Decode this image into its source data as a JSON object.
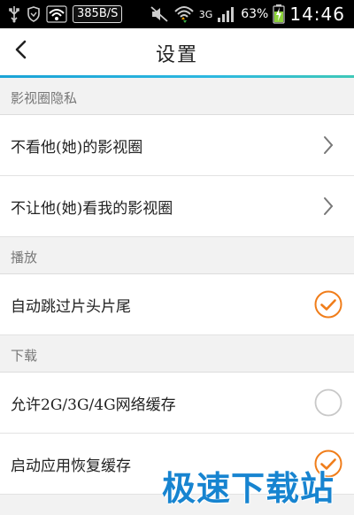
{
  "status_bar": {
    "net_speed": "385B/S",
    "network_type": "3G",
    "battery": "63%",
    "time": "14:46",
    "icons": [
      "usb-icon",
      "shield-icon",
      "wifi-icon",
      "mute-icon",
      "wifi-data-icon",
      "signal-icon",
      "battery-icon"
    ]
  },
  "header": {
    "title": "设置",
    "back_icon": "chevron-left-icon",
    "accent_color": "#1aa3d6"
  },
  "sections": [
    {
      "label": "影视圈隐私",
      "rows": [
        {
          "label": "不看他(她)的影视圈",
          "action": "chevron-right"
        },
        {
          "label": "不让他(她)看我的影视圈",
          "action": "chevron-right"
        }
      ]
    },
    {
      "label": "播放",
      "rows": [
        {
          "label": "自动跳过片头片尾",
          "action": "checked"
        }
      ]
    },
    {
      "label": "下载",
      "rows": [
        {
          "label": "允许2G/3G/4G网络缓存",
          "action": "unchecked"
        },
        {
          "label": "启动应用恢复缓存",
          "action": "checked"
        }
      ]
    }
  ],
  "colors": {
    "check": "#f07d1a",
    "unchecked_ring": "#c8c8c8"
  },
  "watermark": "极速下载站"
}
